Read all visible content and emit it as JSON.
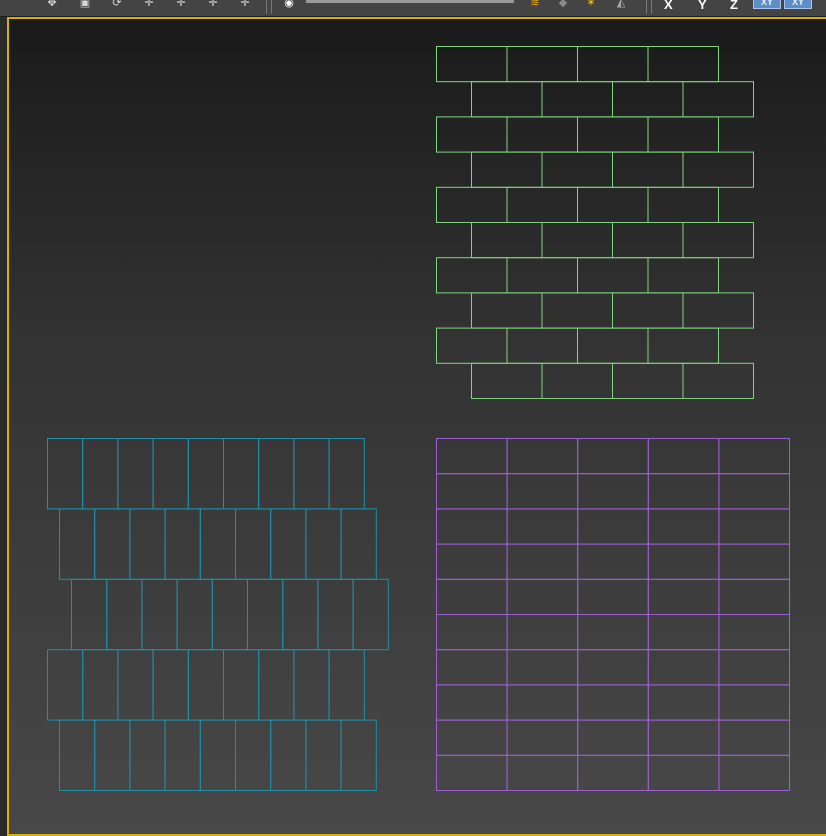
{
  "toolbar": {
    "icons": [
      "select-move-icon",
      "scale-icon",
      "rotate-icon",
      "snap-icon",
      "snap-angle-icon",
      "snap-percent-icon",
      "spinner-snap-icon",
      "render-icon",
      "layer-icon",
      "material-icon",
      "render-frame-icon"
    ],
    "axis_labels": [
      "X",
      "Y",
      "Z"
    ],
    "view_buttons": [
      "XY",
      "XY"
    ]
  },
  "viewport": {
    "accent": "#d9b000",
    "objects": [
      {
        "name": "running-bond-brick-wall",
        "color": "#7fd57f"
      },
      {
        "name": "vertical-staggered-tiles",
        "color": "#1f8fa8"
      },
      {
        "name": "stacked-grid-tiles",
        "color": "#9b5fd0"
      }
    ]
  }
}
